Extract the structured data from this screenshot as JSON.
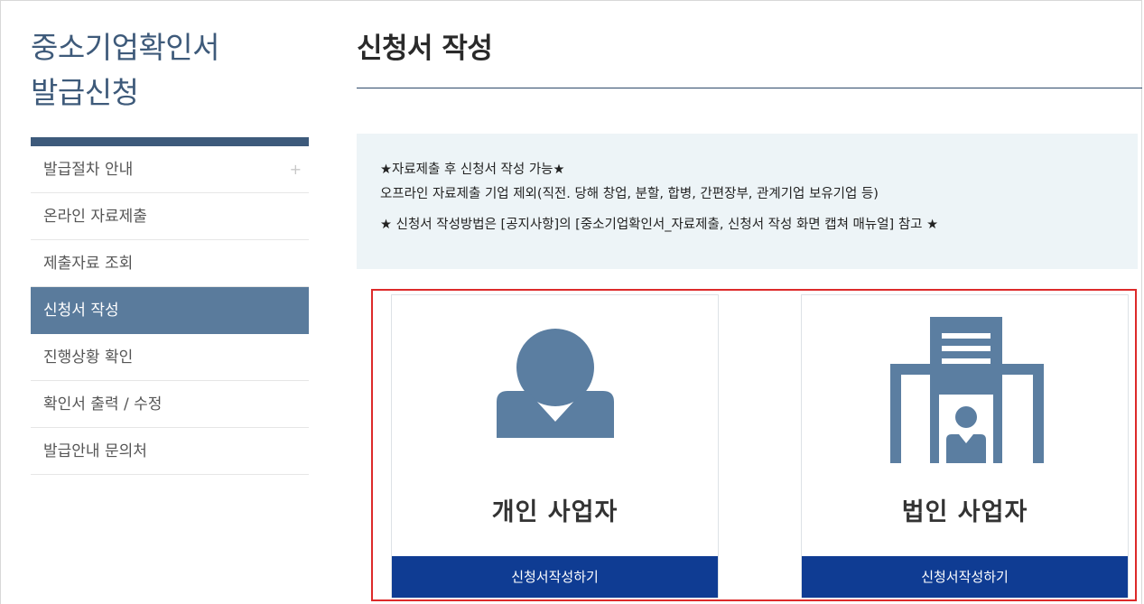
{
  "sidebar": {
    "title_line1": "중소기업확인서",
    "title_line2": "발급신청",
    "items": [
      {
        "label": "발급절차 안내",
        "has_plus": true
      },
      {
        "label": "온라인 자료제출"
      },
      {
        "label": "제출자료 조회"
      },
      {
        "label": "신청서 작성",
        "active": true
      },
      {
        "label": "진행상황 확인"
      },
      {
        "label": "확인서 출력 / 수정"
      },
      {
        "label": "발급안내 문의처"
      }
    ],
    "plus_glyph": "+"
  },
  "main": {
    "title": "신청서 작성",
    "notice": {
      "line1": "★자료제출 후 신청서 작성 가능★",
      "line2": "오프라인 자료제출 기업 제외(직전. 당해 창업, 분할, 합병, 간편장부, 관계기업 보유기업 등)",
      "line3": "★ 신청서 작성방법은 [공지사항]의 [중소기업확인서_자료제출, 신청서 작성 화면 캡쳐 매뉴얼] 참고 ★"
    },
    "cards": [
      {
        "label": "개인 사업자",
        "button": "신청서작성하기",
        "icon": "person-icon"
      },
      {
        "label": "법인 사업자",
        "button": "신청서작성하기",
        "icon": "building-icon"
      }
    ]
  },
  "colors": {
    "accent": "#3d5a7b",
    "active_menu": "#5a7b9c",
    "icon_fill": "#5b7ea1",
    "button": "#0f3c93",
    "highlight_border": "#dd2a2a",
    "notice_bg": "#edf4f7"
  }
}
